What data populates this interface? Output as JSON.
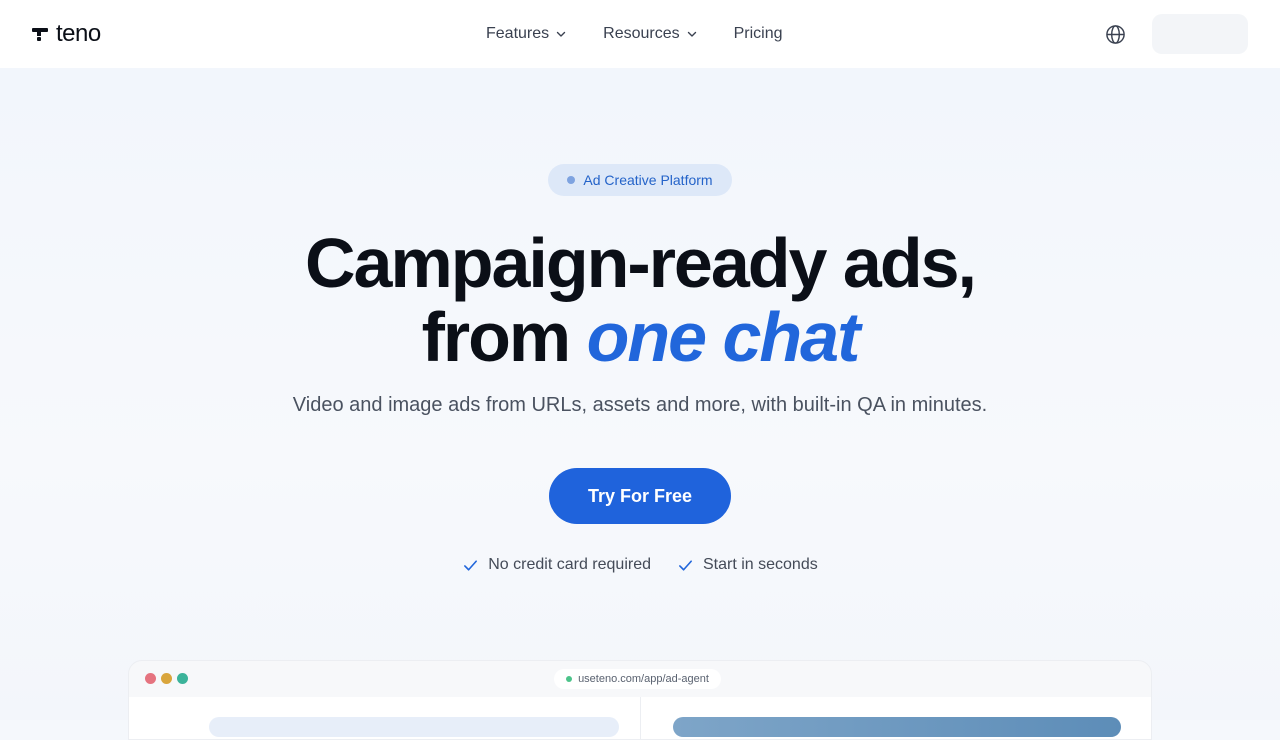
{
  "brand": {
    "name": "teno",
    "icon": "teno-logo-icon"
  },
  "nav": {
    "items": [
      {
        "label": "Features",
        "has_dropdown": true
      },
      {
        "label": "Resources",
        "has_dropdown": true
      },
      {
        "label": "Pricing",
        "has_dropdown": false
      }
    ],
    "language_icon": "globe-icon"
  },
  "hero": {
    "badge": "Ad Creative Platform",
    "headline_line1": "Campaign-ready ads,",
    "headline_line2_prefix": "from ",
    "headline_line2_accent": "one chat",
    "subheadline": "Video and image ads from URLs, assets and more, with built-in QA in minutes.",
    "cta_label": "Try For Free",
    "perks": [
      "No credit card required",
      "Start in seconds"
    ]
  },
  "preview_window": {
    "url": "useteno.com/app/ad-agent",
    "traffic_lights": [
      "#e5737f",
      "#d9a53c",
      "#3bb39a"
    ]
  },
  "colors": {
    "accent": "#1f63dc",
    "accent_text": "#2166db",
    "badge_bg": "#dde8f8",
    "text_primary": "#0b0f17"
  }
}
